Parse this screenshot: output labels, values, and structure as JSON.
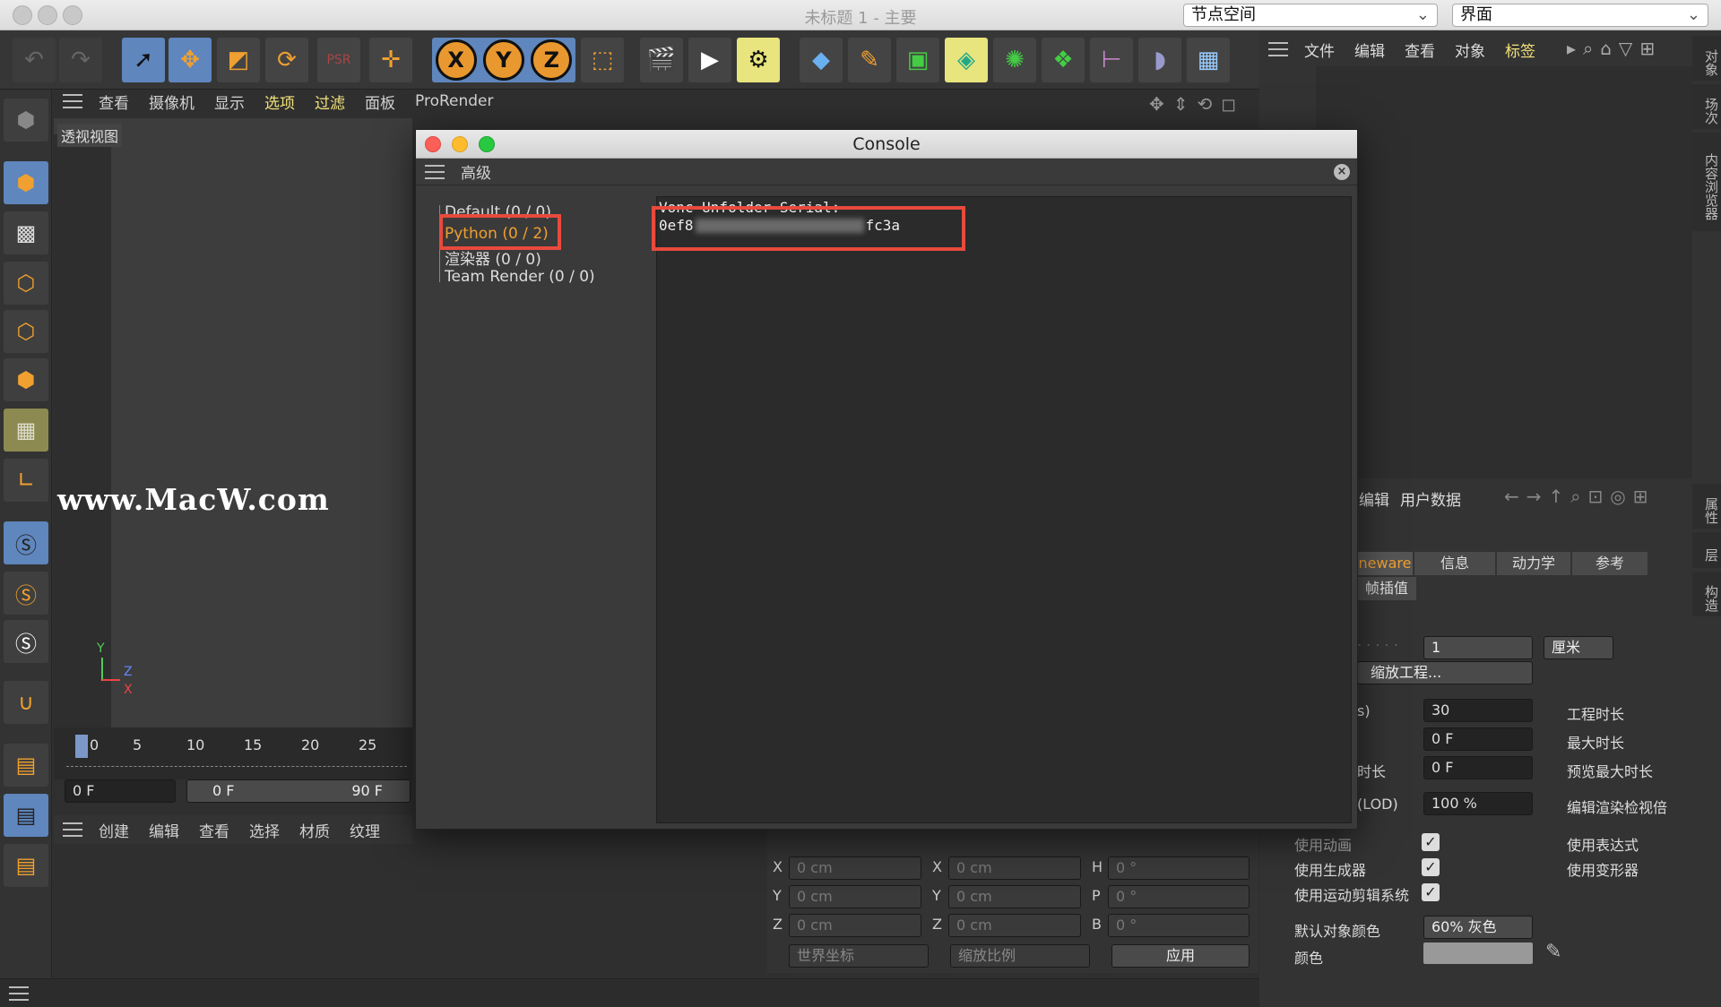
{
  "window": {
    "title": "未标题 1 - 主要",
    "node_space": "节点空间",
    "layout": "界面"
  },
  "main_toolbar": {
    "axis_x": "X",
    "axis_y": "Y",
    "axis_z": "Z",
    "icons": [
      "undo-icon",
      "redo-icon",
      "select-icon",
      "move-icon",
      "scale-icon",
      "rotate-icon",
      "psr-icon",
      "axis-move-icon",
      "coord-system-icon",
      "render-view-icon",
      "render-play-icon",
      "render-settings-icon",
      "cube-icon",
      "pen-icon",
      "subdivision-icon",
      "deform-icon",
      "mograph-icon",
      "cloner-icon",
      "spline-icon",
      "sky-icon",
      "floor-icon"
    ]
  },
  "viewport_menu": [
    "查看",
    "摄像机",
    "显示",
    "选项",
    "过滤",
    "面板",
    "ProRender"
  ],
  "viewport": {
    "label": "透视视图",
    "watermark": "www.MacW.com",
    "axis_y": "Y",
    "axis_z": "Z",
    "axis_x": "X"
  },
  "timeline": {
    "ticks": [
      "0",
      "5",
      "10",
      "15",
      "20",
      "25"
    ],
    "start_field": "0 F",
    "range_start": "0 F",
    "range_end": "90 F"
  },
  "material_menu": [
    "创建",
    "编辑",
    "查看",
    "选择",
    "材质",
    "纹理"
  ],
  "console": {
    "title": "Console",
    "menu_label": "高级",
    "tree": [
      {
        "label": "Default (0 / 0)"
      },
      {
        "label": "Python (0 / 2)"
      },
      {
        "label": "渲染器 (0 / 0)"
      },
      {
        "label": "Team Render  (0 / 0)"
      }
    ],
    "output_line1": "Vonc Unfolder Serial:",
    "serial_start": "0ef8",
    "serial_end": "fc3a"
  },
  "right_panel": {
    "objects_menu": [
      "文件",
      "编辑",
      "查看",
      "对象",
      "标签"
    ],
    "side_tabs_top": [
      "对象",
      "场次",
      "内容浏览器"
    ],
    "side_tabs_bottom": [
      "属性",
      "层",
      "构造"
    ],
    "attr_menu": [
      "编辑",
      "用户数据"
    ],
    "tabs": [
      "neware",
      "信息",
      "动力学",
      "参考"
    ],
    "subtab": "帧插值",
    "scale_value": "1",
    "scale_unit": "厘米",
    "scale_project_button": "缩放工程...",
    "fps_label": "s)",
    "fps_value": "30",
    "project_length_label": "工程时长",
    "min_time_value": "0 F",
    "max_time_label": "最大时长",
    "preview_min_label": "时长",
    "preview_min_value": "0 F",
    "preview_max_label": "预览最大时长",
    "lod_label": "(LOD)",
    "lod_value": "100 %",
    "render_lod_label": "编辑渲染检视倍",
    "use_animation": "使用动画",
    "use_expressions": "使用表达式",
    "use_generators": "使用生成器",
    "use_deformers": "使用变形器",
    "use_motion_system": "使用运动剪辑系统",
    "default_color_label": "默认对象颜色",
    "default_color_value": "60% 灰色",
    "color_label": "颜色"
  },
  "coordinates": {
    "rows": [
      {
        "a": "X",
        "av": "0 cm",
        "b": "X",
        "bv": "0 cm",
        "c": "H",
        "cv": "0 °"
      },
      {
        "a": "Y",
        "av": "0 cm",
        "b": "Y",
        "bv": "0 cm",
        "c": "P",
        "cv": "0 °"
      },
      {
        "a": "Z",
        "av": "0 cm",
        "b": "Z",
        "bv": "0 cm",
        "c": "B",
        "cv": "0 °"
      }
    ],
    "world": "世界坐标",
    "scale": "缩放比例",
    "apply": "应用"
  },
  "colors": {
    "accent_orange": "#f0a030",
    "highlight_yellow": "#f2e27a",
    "redbox": "#e84a3d",
    "tool_blue": "#5f86bd"
  }
}
